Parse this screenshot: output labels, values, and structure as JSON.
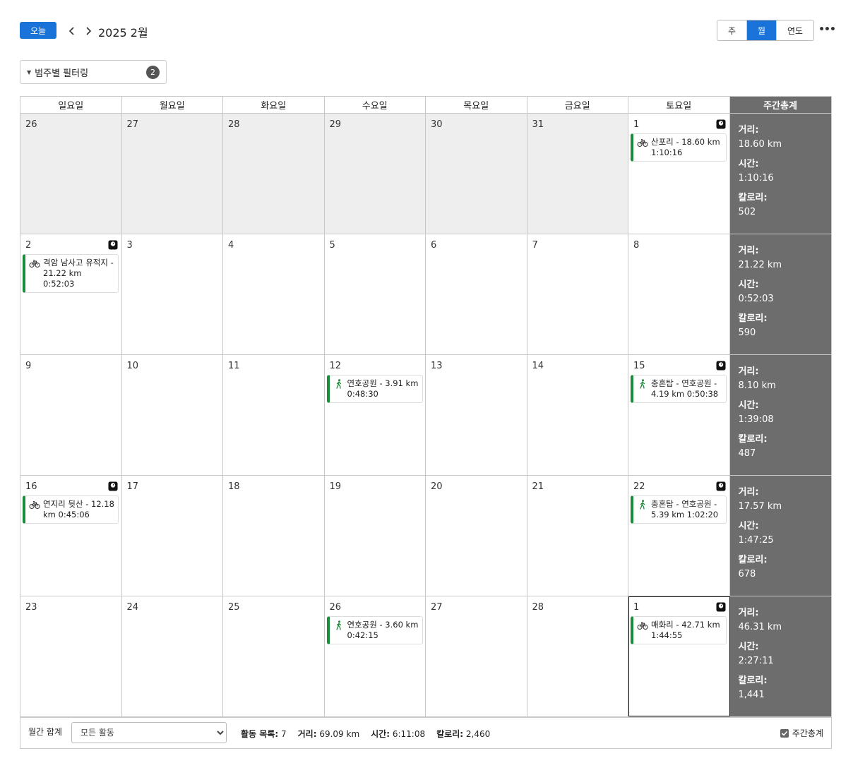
{
  "toolbar": {
    "today_label": "오늘",
    "month_title": "2025 2월",
    "views": [
      "주",
      "월",
      "연도"
    ],
    "active_view": "월",
    "more_label": "•••"
  },
  "filter": {
    "label": "범주별 필터링",
    "count": "2"
  },
  "weekdays": [
    "일요일",
    "월요일",
    "화요일",
    "수요일",
    "목요일",
    "금요일",
    "토요일"
  ],
  "total_header": "주간총계",
  "total_labels": {
    "distance": "거리:",
    "time": "시간:",
    "calories": "칼로리:"
  },
  "weeks": [
    {
      "days": [
        {
          "num": "26",
          "other": true
        },
        {
          "num": "27",
          "other": true
        },
        {
          "num": "28",
          "other": true
        },
        {
          "num": "29",
          "other": true
        },
        {
          "num": "30",
          "other": true
        },
        {
          "num": "31",
          "other": true
        },
        {
          "num": "1",
          "weigh": true,
          "activity": {
            "type": "bike",
            "text": "산포리 - 18.60 km 1:10:16"
          }
        }
      ],
      "totals": {
        "distance": "18.60 km",
        "time": "1:10:16",
        "calories": "502"
      }
    },
    {
      "days": [
        {
          "num": "2",
          "weigh": true,
          "activity": {
            "type": "bike",
            "text": "격암 남사고 유적지 - 21.22 km 0:52:03"
          }
        },
        {
          "num": "3"
        },
        {
          "num": "4"
        },
        {
          "num": "5"
        },
        {
          "num": "6"
        },
        {
          "num": "7"
        },
        {
          "num": "8"
        }
      ],
      "totals": {
        "distance": "21.22 km",
        "time": "0:52:03",
        "calories": "590"
      }
    },
    {
      "days": [
        {
          "num": "9"
        },
        {
          "num": "10"
        },
        {
          "num": "11"
        },
        {
          "num": "12",
          "activity": {
            "type": "walk",
            "text": "연호공원 - 3.91 km 0:48:30"
          }
        },
        {
          "num": "13"
        },
        {
          "num": "14"
        },
        {
          "num": "15",
          "weigh": true,
          "activity": {
            "type": "walk",
            "text": "충혼탑 - 연호공원 - 4.19 km 0:50:38"
          }
        }
      ],
      "totals": {
        "distance": "8.10 km",
        "time": "1:39:08",
        "calories": "487"
      }
    },
    {
      "days": [
        {
          "num": "16",
          "weigh": true,
          "activity": {
            "type": "bike",
            "text": "연지리 뒷산 - 12.18 km 0:45:06"
          }
        },
        {
          "num": "17"
        },
        {
          "num": "18"
        },
        {
          "num": "19"
        },
        {
          "num": "20"
        },
        {
          "num": "21"
        },
        {
          "num": "22",
          "weigh": true,
          "activity": {
            "type": "walk",
            "text": "충혼탑 - 연호공원 - 5.39 km 1:02:20"
          }
        }
      ],
      "totals": {
        "distance": "17.57 km",
        "time": "1:47:25",
        "calories": "678"
      }
    },
    {
      "days": [
        {
          "num": "23"
        },
        {
          "num": "24"
        },
        {
          "num": "25"
        },
        {
          "num": "26",
          "activity": {
            "type": "walk",
            "text": "연호공원 - 3.60 km 0:42:15"
          }
        },
        {
          "num": "27"
        },
        {
          "num": "28"
        },
        {
          "num": "1",
          "weigh": true,
          "today": true,
          "activity": {
            "type": "bike",
            "text": "매화리 - 42.71 km 1:44:55"
          }
        }
      ],
      "totals": {
        "distance": "46.31 km",
        "time": "2:27:11",
        "calories": "1,441"
      }
    }
  ],
  "footer": {
    "title": "월간 합계",
    "select_value": "모든 활동",
    "stats": [
      {
        "label": "활동 목록:",
        "value": "7"
      },
      {
        "label": "거리:",
        "value": "69.09 km"
      },
      {
        "label": "시간:",
        "value": "6:11:08"
      },
      {
        "label": "칼로리:",
        "value": "2,460"
      }
    ],
    "weekly_total_label": "주간총계"
  },
  "colors": {
    "accent": "#1a73d9",
    "activity_bar": "#1a8c3a",
    "total_bg": "#6d6d6d",
    "other_month_bg": "#eeeeee"
  }
}
